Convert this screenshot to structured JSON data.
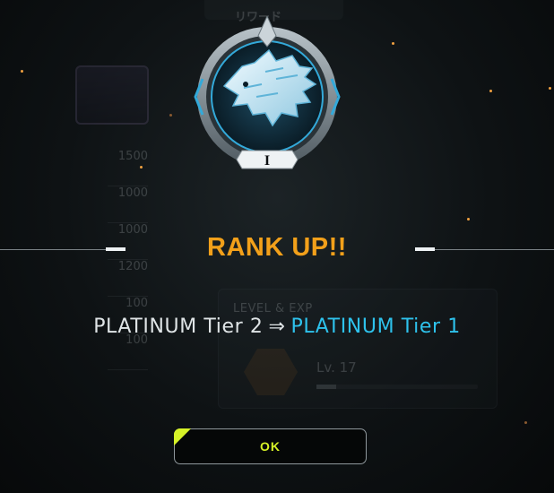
{
  "background": {
    "top_panel_label": "リワード",
    "reward_values": [
      "1500",
      "1000",
      "1000",
      "1200",
      "100",
      "100"
    ],
    "level_section_title": "LEVEL & EXP",
    "level_text": "Lv. 17",
    "level_progress": 0.12
  },
  "emblem": {
    "tier_numeral": "I",
    "icon": "wolf-emblem-icon"
  },
  "dialog": {
    "heading": "RANK UP!!",
    "from_rank": "PLATINUM Tier 2",
    "arrow": "⇒",
    "to_rank": "PLATINUM Tier 1",
    "ok_label": "OK"
  },
  "colors": {
    "heading": "#f2a01a",
    "to_rank": "#2ec2ec",
    "ok_accent": "#d6f227"
  }
}
